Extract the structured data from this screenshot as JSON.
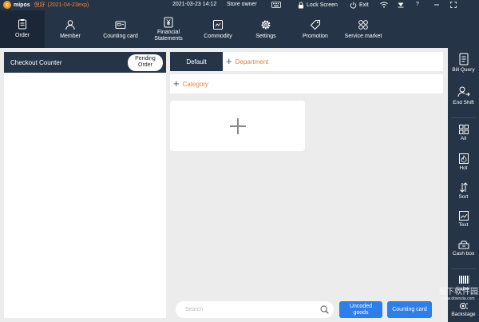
{
  "app": {
    "logo_text": "mipos",
    "user_name": "倪好",
    "expiry": "(2021-04-23exp)",
    "datetime": "2021-03-23 14:12",
    "role": "Store owner",
    "lock_label": "Lock Screen",
    "exit_label": "Exit",
    "help_label": "?"
  },
  "nav": {
    "items": [
      {
        "label": "Order",
        "icon": "clipboard-icon",
        "active": true
      },
      {
        "label": "Member",
        "icon": "person-icon"
      },
      {
        "label": "Counting card",
        "icon": "card-icon"
      },
      {
        "label": "Financial\nStatements",
        "icon": "yen-document-icon"
      },
      {
        "label": "Commodity",
        "icon": "box-icon"
      },
      {
        "label": "Settings",
        "icon": "gear-icon"
      },
      {
        "label": "Promotion",
        "icon": "tag-icon"
      },
      {
        "label": "Service market",
        "icon": "apps-icon"
      }
    ]
  },
  "checkout": {
    "title": "Checkout Counter",
    "pending_label": "Pending\nOrder"
  },
  "tabs": {
    "default_label": "Default",
    "add_department_label": "Department",
    "add_category_label": "Category"
  },
  "search": {
    "placeholder": "Search"
  },
  "bottom": {
    "uncoded_label": "Uncoded\ngoods",
    "counting_card_label": "Counting card"
  },
  "rightbar": {
    "items": [
      {
        "label": "Bill Query",
        "icon": "bill-icon"
      },
      {
        "label": "End Shift",
        "icon": "handover-icon"
      },
      {
        "label": "All",
        "icon": "grid-icon"
      },
      {
        "label": "Hot",
        "icon": "fire-icon"
      },
      {
        "label": "Sort",
        "icon": "sort-icon"
      },
      {
        "label": "Text",
        "icon": "text-image-icon"
      },
      {
        "label": "Cash box",
        "icon": "cashbox-icon"
      },
      {
        "label": "Label",
        "icon": "barcode-icon"
      },
      {
        "label": "Backstage",
        "icon": "backstage-icon"
      }
    ]
  },
  "watermark": {
    "text": "当下软件园",
    "url": "www.downxia.com"
  },
  "colors": {
    "navy": "#253447",
    "accent_orange": "#e8843a",
    "button_blue": "#2d7ee8"
  }
}
